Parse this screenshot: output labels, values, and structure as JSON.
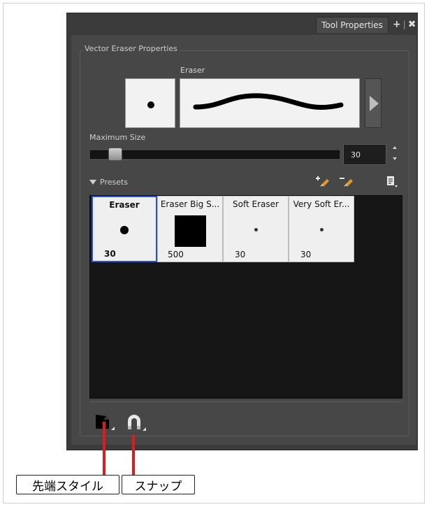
{
  "panel": {
    "tab_title": "Tool Properties",
    "controls": {
      "add": "+",
      "separator": "|",
      "close": "✖"
    },
    "group_title": "Vector Eraser Properties"
  },
  "eraser_preview": {
    "label": "Eraser"
  },
  "maximum_size": {
    "label": "Maximum Size",
    "value": "30",
    "slider_fraction": 0.08
  },
  "presets": {
    "header_label": "Presets",
    "items": [
      {
        "name": "Eraser",
        "size": "30",
        "selected": true,
        "mark": "dot"
      },
      {
        "name": "Eraser Big S...",
        "size": "500",
        "selected": false,
        "mark": "square"
      },
      {
        "name": "Soft Eraser",
        "size": "30",
        "selected": false,
        "mark": "small-dot"
      },
      {
        "name": "Very Soft Er...",
        "size": "30",
        "selected": false,
        "mark": "small-dot"
      }
    ]
  },
  "callouts": {
    "tip_style": "先端スタイル",
    "snap": "スナップ"
  },
  "colors": {
    "panel_bg": "#474747",
    "selection": "#2b4fd6",
    "callout_line": "#e01b1b"
  }
}
